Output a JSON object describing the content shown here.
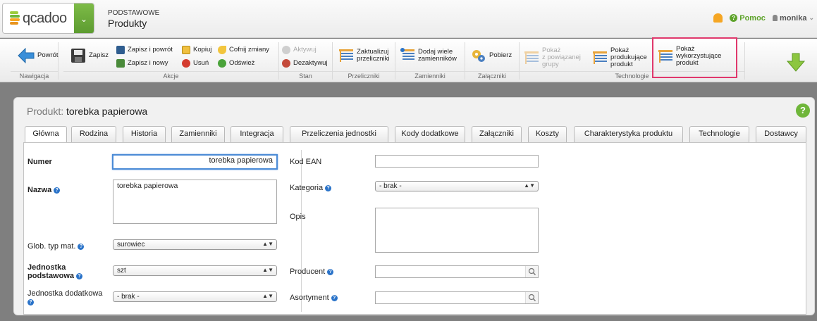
{
  "header": {
    "logo_text": "qcadoo",
    "crumb_sub": "PODSTAWOWE",
    "crumb_main": "Produkty",
    "help_label": "Pomoc",
    "user_name": "monika"
  },
  "ribbon": {
    "nav": {
      "back": "Powrót",
      "label": "Nawigacja"
    },
    "actions": {
      "save": "Zapisz",
      "save_back": "Zapisz i powrót",
      "save_new": "Zapisz i nowy",
      "copy": "Kopiuj",
      "delete": "Usuń",
      "undo": "Cofnij zmiany",
      "refresh": "Odśwież",
      "label": "Akcje"
    },
    "state": {
      "activate": "Aktywuj",
      "deactivate": "Dezaktywuj",
      "label": "Stan"
    },
    "converters": {
      "update_l1": "Zaktualizuj",
      "update_l2": "przeliczniki",
      "label": "Przeliczniki"
    },
    "substitutes": {
      "add_l1": "Dodaj wiele",
      "add_l2": "zamienników",
      "label": "Zamienniki"
    },
    "attachments": {
      "download": "Pobierz",
      "label": "Załączniki"
    },
    "technologies": {
      "group_l1": "Pokaż",
      "group_l2": "z powiązanej",
      "group_l3": "grupy",
      "producing_l1": "Pokaż",
      "producing_l2": "produkujące",
      "producing_l3": "produkt",
      "using_l1": "Pokaż",
      "using_l2": "wykorzystujące",
      "using_l3": "produkt",
      "label": "Technologie"
    }
  },
  "panel": {
    "title_prefix": "Produkt:",
    "title_value": "torebka papierowa",
    "tabs": [
      "Główna",
      "Rodzina",
      "Historia",
      "Zamienniki",
      "Integracja",
      "Przeliczenia jednostki",
      "Kody dodatkowe",
      "Załączniki",
      "Koszty",
      "Charakterystyka produktu",
      "Technologie",
      "Dostawcy"
    ]
  },
  "form": {
    "number_label": "Numer",
    "number_value": "torebka papierowa",
    "name_label": "Nazwa",
    "name_value": "torebka papierowa",
    "glob_type_label": "Glob. typ mat.",
    "glob_type_value": "surowiec",
    "unit_label_l1": "Jednostka",
    "unit_label_l2": "podstawowa",
    "unit_value": "szt",
    "add_unit_label": "Jednostka dodatkowa",
    "add_unit_value": "- brak -",
    "ean_label": "Kod EAN",
    "ean_value": "",
    "category_label": "Kategoria",
    "category_value": "- brak -",
    "description_label": "Opis",
    "description_value": "",
    "producer_label": "Producent",
    "producer_value": "",
    "assortment_label": "Asortyment",
    "assortment_value": ""
  },
  "colors": {
    "accent_green": "#6fb63a",
    "highlight_border": "#e0386c",
    "focus_blue": "#4b8bd6"
  }
}
